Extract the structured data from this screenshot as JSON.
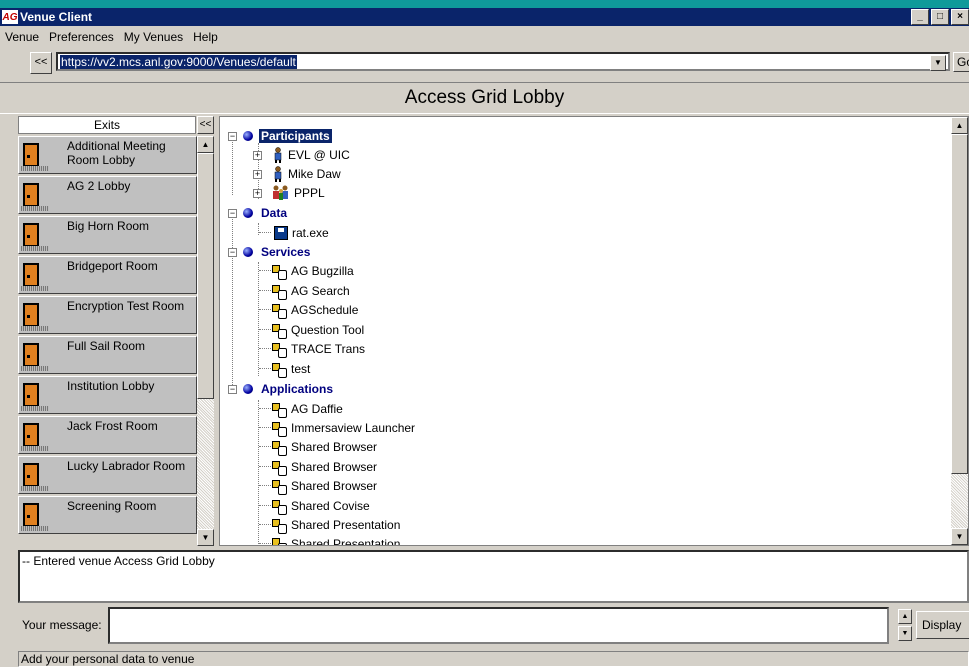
{
  "window": {
    "title": "Venue Client",
    "app_icon_text": "AG",
    "controls": {
      "minimize": "_",
      "maximize": "□",
      "close": "×"
    }
  },
  "menubar": {
    "items": [
      {
        "label": "Venue"
      },
      {
        "label": "Preferences"
      },
      {
        "label": "My Venues"
      },
      {
        "label": "Help"
      }
    ]
  },
  "urlbar": {
    "back_label": "<<",
    "url": "https://vv2.mcs.anl.gov:9000/Venues/default",
    "dropdown": "▼",
    "go_label": "Go"
  },
  "venue": {
    "title": "Access Grid Lobby"
  },
  "exits": {
    "header": "Exits",
    "collapse_label": "<<",
    "items": [
      {
        "label": "Additional Meeting Room Lobby"
      },
      {
        "label": "AG 2 Lobby"
      },
      {
        "label": "Big Horn Room"
      },
      {
        "label": "Bridgeport Room"
      },
      {
        "label": "Encryption Test Room"
      },
      {
        "label": "Full Sail Room"
      },
      {
        "label": "Institution Lobby"
      },
      {
        "label": "Jack Frost Room"
      },
      {
        "label": "Lucky Labrador Room"
      },
      {
        "label": "Screening Room"
      }
    ],
    "scroll_up": "▲",
    "scroll_down": "▼"
  },
  "tree": {
    "participants": {
      "label": "Participants",
      "items": [
        {
          "label": "EVL @ UIC"
        },
        {
          "label": "Mike Daw"
        },
        {
          "label": "PPPL"
        }
      ]
    },
    "data": {
      "label": "Data",
      "items": [
        {
          "label": "rat.exe"
        }
      ]
    },
    "services": {
      "label": "Services",
      "items": [
        {
          "label": "AG Bugzilla"
        },
        {
          "label": "AG Search"
        },
        {
          "label": "AGSchedule"
        },
        {
          "label": "Question Tool"
        },
        {
          "label": "TRACE Trans"
        },
        {
          "label": "test"
        }
      ]
    },
    "applications": {
      "label": "Applications",
      "items": [
        {
          "label": "AG Daffie"
        },
        {
          "label": "Immersaview Launcher"
        },
        {
          "label": "Shared Browser"
        },
        {
          "label": "Shared Browser"
        },
        {
          "label": "Shared Browser"
        },
        {
          "label": "Shared Covise"
        },
        {
          "label": "Shared Presentation"
        },
        {
          "label": "Shared Presentation"
        }
      ]
    },
    "expand_minus": "−",
    "expand_plus": "+"
  },
  "log": {
    "text": "-- Entered venue Access Grid Lobby"
  },
  "message": {
    "label": "Your message:",
    "value": "",
    "display_label": "Display",
    "spin_up": "▲",
    "spin_down": "▼"
  },
  "status": {
    "text": "Add your personal data to venue"
  },
  "colors": {
    "desktop": "#0f9a9a",
    "titlebar": "#0a246a",
    "selection": "#0a246a",
    "category_text": "#00007f",
    "door": "#e08020"
  }
}
